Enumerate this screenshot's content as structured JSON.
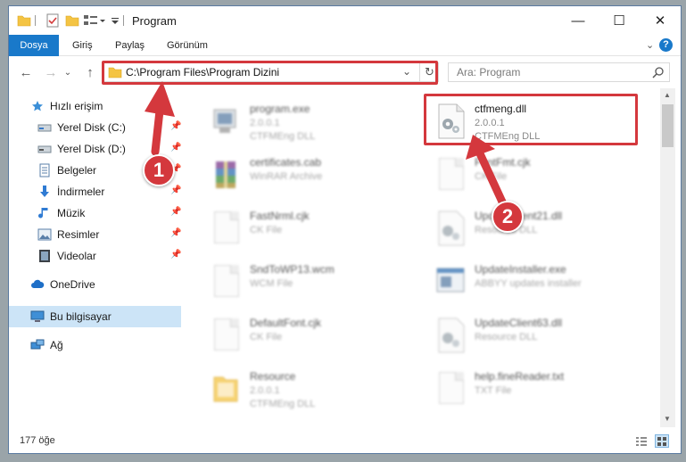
{
  "window": {
    "title": "Program",
    "controls": {
      "minimize": "—",
      "maximize": "☐",
      "close": "✕"
    }
  },
  "ribbon": {
    "tabs": [
      "Dosya",
      "Giriş",
      "Paylaş",
      "Görünüm"
    ],
    "help": "?"
  },
  "address_bar": {
    "path": "C:\\Program Files\\Program Dizini",
    "search_placeholder": "Ara: Program"
  },
  "nav_pane": {
    "quick_access": "Hızlı erişim",
    "items": [
      {
        "label": "Yerel Disk (C:)",
        "icon": "drive-icon",
        "pinned": true
      },
      {
        "label": "Yerel Disk (D:)",
        "icon": "drive-icon",
        "pinned": true
      },
      {
        "label": "Belgeler",
        "icon": "documents-icon",
        "pinned": true
      },
      {
        "label": "İndirmeler",
        "icon": "download-icon",
        "pinned": true
      },
      {
        "label": "Müzik",
        "icon": "music-icon",
        "pinned": true
      },
      {
        "label": "Resimler",
        "icon": "pictures-icon",
        "pinned": true
      },
      {
        "label": "Videolar",
        "icon": "videos-icon",
        "pinned": true
      }
    ],
    "onedrive": "OneDrive",
    "this_pc": "Bu bilgisayar",
    "network": "Ağ"
  },
  "files": [
    {
      "name": "program.exe",
      "line2": "2.0.0.1",
      "line3": "CTFMEng DLL",
      "icon": "exe-icon",
      "blurred": true
    },
    {
      "name": "ctfmeng.dll",
      "line2": "2.0.0.1",
      "line3": "CTFMEng DLL",
      "icon": "dll-gear-icon",
      "blurred": false
    },
    {
      "name": "certificates.cab",
      "line2": "WinRAR Archive",
      "line3": "",
      "icon": "winrar-icon",
      "blurred": true
    },
    {
      "name": "FontFmt.cjk",
      "line2": "CK File",
      "line3": "",
      "icon": "file-icon",
      "blurred": true
    },
    {
      "name": "FastNrml.cjk",
      "line2": "CK File",
      "line3": "",
      "icon": "file-icon",
      "blurred": true
    },
    {
      "name": "UpdateClient21.dll",
      "line2": "Resource DLL",
      "line3": "",
      "icon": "dll-gear-icon",
      "blurred": true
    },
    {
      "name": "SndToWP13.wcm",
      "line2": "WCM File",
      "line3": "",
      "icon": "file-icon",
      "blurred": true
    },
    {
      "name": "UpdateInstaller.exe",
      "line2": "ABBYY updates installer",
      "line3": "",
      "icon": "installer-icon",
      "blurred": true
    },
    {
      "name": "DefaultFont.cjk",
      "line2": "CK File",
      "line3": "",
      "icon": "file-icon",
      "blurred": true
    },
    {
      "name": "UpdateClient63.dll",
      "line2": "Resource DLL",
      "line3": "",
      "icon": "dll-gear-icon",
      "blurred": true
    },
    {
      "name": "Resource",
      "line2": "2.0.0.1",
      "line3": "CTFMEng DLL",
      "icon": "folder-icon",
      "blurred": true
    },
    {
      "name": "help.fineReader.txt",
      "line2": "TXT File",
      "line3": "",
      "icon": "file-icon",
      "blurred": true
    }
  ],
  "status": {
    "count": "177 öğe"
  },
  "annotations": {
    "callout1": "1",
    "callout2": "2"
  },
  "colors": {
    "accent": "#1979ca",
    "highlight": "#d4383d",
    "selection": "#cce4f7"
  }
}
